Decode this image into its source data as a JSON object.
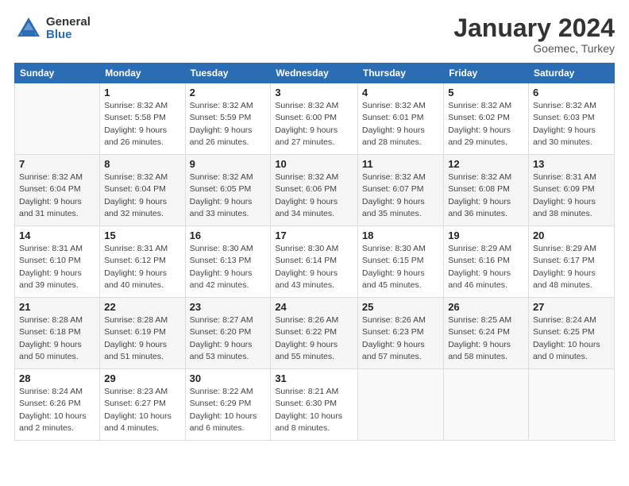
{
  "logo": {
    "general": "General",
    "blue": "Blue"
  },
  "title": {
    "month": "January 2024",
    "location": "Goemec, Turkey"
  },
  "days_of_week": [
    "Sunday",
    "Monday",
    "Tuesday",
    "Wednesday",
    "Thursday",
    "Friday",
    "Saturday"
  ],
  "weeks": [
    [
      {
        "day": "",
        "info": ""
      },
      {
        "day": "1",
        "info": "Sunrise: 8:32 AM\nSunset: 5:58 PM\nDaylight: 9 hours\nand 26 minutes."
      },
      {
        "day": "2",
        "info": "Sunrise: 8:32 AM\nSunset: 5:59 PM\nDaylight: 9 hours\nand 26 minutes."
      },
      {
        "day": "3",
        "info": "Sunrise: 8:32 AM\nSunset: 6:00 PM\nDaylight: 9 hours\nand 27 minutes."
      },
      {
        "day": "4",
        "info": "Sunrise: 8:32 AM\nSunset: 6:01 PM\nDaylight: 9 hours\nand 28 minutes."
      },
      {
        "day": "5",
        "info": "Sunrise: 8:32 AM\nSunset: 6:02 PM\nDaylight: 9 hours\nand 29 minutes."
      },
      {
        "day": "6",
        "info": "Sunrise: 8:32 AM\nSunset: 6:03 PM\nDaylight: 9 hours\nand 30 minutes."
      }
    ],
    [
      {
        "day": "7",
        "info": ""
      },
      {
        "day": "8",
        "info": "Sunrise: 8:32 AM\nSunset: 6:04 PM\nDaylight: 9 hours\nand 32 minutes."
      },
      {
        "day": "9",
        "info": "Sunrise: 8:32 AM\nSunset: 6:05 PM\nDaylight: 9 hours\nand 33 minutes."
      },
      {
        "day": "10",
        "info": "Sunrise: 8:32 AM\nSunset: 6:06 PM\nDaylight: 9 hours\nand 34 minutes."
      },
      {
        "day": "11",
        "info": "Sunrise: 8:32 AM\nSunset: 6:07 PM\nDaylight: 9 hours\nand 35 minutes."
      },
      {
        "day": "12",
        "info": "Sunrise: 8:32 AM\nSunset: 6:08 PM\nDaylight: 9 hours\nand 36 minutes."
      },
      {
        "day": "13",
        "info": "Sunrise: 8:31 AM\nSunset: 6:09 PM\nDaylight: 9 hours\nand 38 minutes."
      }
    ],
    [
      {
        "day": "14",
        "info": ""
      },
      {
        "day": "15",
        "info": "Sunrise: 8:31 AM\nSunset: 6:12 PM\nDaylight: 9 hours\nand 40 minutes."
      },
      {
        "day": "16",
        "info": "Sunrise: 8:30 AM\nSunset: 6:13 PM\nDaylight: 9 hours\nand 42 minutes."
      },
      {
        "day": "17",
        "info": "Sunrise: 8:30 AM\nSunset: 6:14 PM\nDaylight: 9 hours\nand 43 minutes."
      },
      {
        "day": "18",
        "info": "Sunrise: 8:30 AM\nSunset: 6:15 PM\nDaylight: 9 hours\nand 45 minutes."
      },
      {
        "day": "19",
        "info": "Sunrise: 8:29 AM\nSunset: 6:16 PM\nDaylight: 9 hours\nand 46 minutes."
      },
      {
        "day": "20",
        "info": "Sunrise: 8:29 AM\nSunset: 6:17 PM\nDaylight: 9 hours\nand 48 minutes."
      }
    ],
    [
      {
        "day": "21",
        "info": ""
      },
      {
        "day": "22",
        "info": "Sunrise: 8:28 AM\nSunset: 6:19 PM\nDaylight: 9 hours\nand 51 minutes."
      },
      {
        "day": "23",
        "info": "Sunrise: 8:27 AM\nSunset: 6:20 PM\nDaylight: 9 hours\nand 53 minutes."
      },
      {
        "day": "24",
        "info": "Sunrise: 8:26 AM\nSunset: 6:22 PM\nDaylight: 9 hours\nand 55 minutes."
      },
      {
        "day": "25",
        "info": "Sunrise: 8:26 AM\nSunset: 6:23 PM\nDaylight: 9 hours\nand 57 minutes."
      },
      {
        "day": "26",
        "info": "Sunrise: 8:25 AM\nSunset: 6:24 PM\nDaylight: 9 hours\nand 58 minutes."
      },
      {
        "day": "27",
        "info": "Sunrise: 8:24 AM\nSunset: 6:25 PM\nDaylight: 10 hours\nand 0 minutes."
      }
    ],
    [
      {
        "day": "28",
        "info": "Sunrise: 8:24 AM\nSunset: 6:26 PM\nDaylight: 10 hours\nand 2 minutes."
      },
      {
        "day": "29",
        "info": "Sunrise: 8:23 AM\nSunset: 6:27 PM\nDaylight: 10 hours\nand 4 minutes."
      },
      {
        "day": "30",
        "info": "Sunrise: 8:22 AM\nSunset: 6:29 PM\nDaylight: 10 hours\nand 6 minutes."
      },
      {
        "day": "31",
        "info": "Sunrise: 8:21 AM\nSunset: 6:30 PM\nDaylight: 10 hours\nand 8 minutes."
      },
      {
        "day": "",
        "info": ""
      },
      {
        "day": "",
        "info": ""
      },
      {
        "day": "",
        "info": ""
      }
    ]
  ],
  "week1_sunday": {
    "day": "7",
    "info": "Sunrise: 8:32 AM\nSunset: 6:04 PM\nDaylight: 9 hours\nand 31 minutes."
  },
  "week3_sunday": {
    "day": "14",
    "info": "Sunrise: 8:31 AM\nSunset: 6:10 PM\nDaylight: 9 hours\nand 39 minutes."
  },
  "week4_sunday": {
    "day": "21",
    "info": "Sunrise: 8:28 AM\nSunset: 6:18 PM\nDaylight: 9 hours\nand 50 minutes."
  }
}
